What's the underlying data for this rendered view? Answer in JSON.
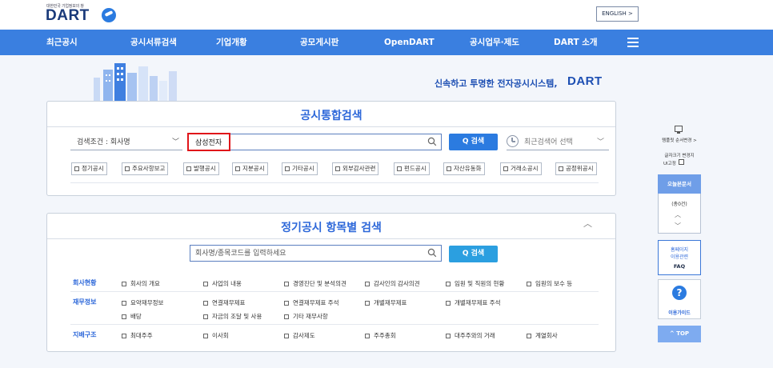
{
  "header": {
    "logo_tagline": "대한민국 기업정보의 창",
    "logo_text": "DART",
    "english_button": "ENGLISH >"
  },
  "nav": {
    "items": [
      "최근공시",
      "공시서류검색",
      "기업개황",
      "공모게시판",
      "OpenDART",
      "공시업무·제도",
      "DART 소개"
    ]
  },
  "hero": {
    "slogan": "신속하고 투명한 전자공시시스템,",
    "slogan_brand": "DART"
  },
  "integrated_search": {
    "title": "공시통합검색",
    "condition": "검색조건 : 회사명",
    "query": "삼성전자",
    "search_button": "Q 검색",
    "recent_placeholder": "최근검색어 선택",
    "filters": [
      "정기공시",
      "주요사항보고",
      "발행공시",
      "지분공시",
      "기타공시",
      "외부감사관련",
      "펀드공시",
      "자산유동화",
      "거래소공시",
      "공정위공시"
    ]
  },
  "periodic_search": {
    "title": "정기공시 항목별 검색",
    "placeholder": "회사명/종목코드를 입력하세요",
    "search_button": "Q 검색",
    "rows": [
      {
        "category": "회사현황",
        "options": [
          "회사의 개요",
          "사업의 내용",
          "경영진단 및 분석의견",
          "감사인의 감사의견",
          "임원 및 직원의 현황",
          "임원의 보수 등"
        ]
      },
      {
        "category": "재무정보",
        "options": [
          "요약재무정보",
          "연결재무제표",
          "연결재무제표 주석",
          "개별재무제표",
          "개별재무제표 주석"
        ]
      },
      {
        "category": "",
        "options": [
          "배당",
          "자금의 조달 및 사용",
          "기타 재무사항"
        ]
      },
      {
        "category": "지배구조",
        "options": [
          "최대주주",
          "이사회",
          "감사제도",
          "주주총회",
          "대주주와의 거래",
          "계열회사"
        ]
      }
    ]
  },
  "sidebar": {
    "template_order": "템플릿 순서변경 >",
    "font_size_label_1": "글자크기 변경지",
    "font_size_label_2": "UI고정",
    "today_docs": "오늘본문서",
    "count": "(총0건)",
    "homepage_guide_1": "홈페이지",
    "homepage_guide_2": "이용관련",
    "faq": "FAQ",
    "usage_guide": "이용가이드",
    "top": "^ TOP"
  }
}
